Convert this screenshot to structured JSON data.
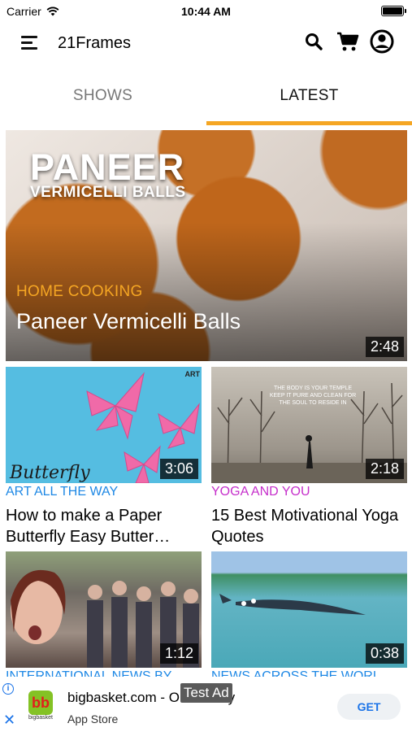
{
  "status_bar": {
    "carrier": "Carrier",
    "time": "10:44 AM"
  },
  "app_bar": {
    "title": "21Frames",
    "icons": [
      "menu-icon",
      "search-icon",
      "cart-icon",
      "account-icon"
    ]
  },
  "tabs": [
    {
      "label": "SHOWS",
      "active": false
    },
    {
      "label": "LATEST",
      "active": true
    }
  ],
  "colors": {
    "accent": "#f5a623",
    "link_blue": "#1e88e5",
    "purple": "#c62fcb"
  },
  "hero": {
    "banner_line1": "PANEER",
    "banner_line2": "VERMICELLI BALLS",
    "category": "HOME COOKING",
    "title": "Paneer Vermicelli Balls",
    "duration": "2:48"
  },
  "videos": [
    {
      "category": "ART ALL THE WAY",
      "category_color": "#1e88e5",
      "title": "How to make a Paper Butterfly  Easy Butter…",
      "duration": "3:06",
      "thumb_text": "Butterfly",
      "thumb_badge": "ART"
    },
    {
      "category": "YOGA AND YOU",
      "category_color": "#c62fcb",
      "title": "15 Best Motivational Yoga Quotes",
      "duration": "2:18",
      "thumb_quote": "THE BODY IS YOUR TEMPLE KEEP IT PURE AND CLEAN FOR THE SOUL TO RESIDE IN"
    },
    {
      "category": "INTERNATIONAL NEWS BY…",
      "category_color": "#1e88e5",
      "title": "",
      "duration": "1:12"
    },
    {
      "category": "NEWS ACROSS THE WORL…",
      "category_color": "#1e88e5",
      "title": "",
      "duration": "0:38"
    }
  ],
  "ad": {
    "app_name": "bigbasket.com - O",
    "app_name_tail": "cery",
    "store": "App Store",
    "test_label": "Test Ad",
    "button": "GET",
    "logo_text": "bb",
    "logo_sub": "bigbasket"
  }
}
